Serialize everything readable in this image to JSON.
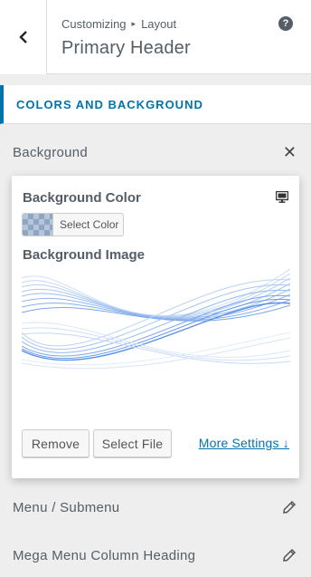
{
  "header": {
    "breadcrumb": [
      "Customizing",
      "Layout"
    ],
    "breadcrumb_separator": "▸",
    "title": "Primary Header",
    "help_icon": "question-mark-icon",
    "back_icon": "chevron-left-icon"
  },
  "section": {
    "heading": "Colors and Background",
    "accent_color": "#0073aa"
  },
  "rows": {
    "background": {
      "label": "Background",
      "action_icon": "close-icon",
      "action_glyph": "✕"
    },
    "menu_submenu": {
      "label": "Menu / Submenu",
      "action_icon": "pencil-icon"
    },
    "mega_menu": {
      "label": "Mega Menu Column Heading",
      "action_icon": "pencil-icon"
    }
  },
  "popup": {
    "bg_color_label": "Background Color",
    "select_color_label": "Select Color",
    "device_icon": "desktop-monitor-icon",
    "bg_image_label": "Background Image",
    "remove_label": "Remove",
    "select_file_label": "Select File",
    "more_settings_label": "More Settings ↓"
  }
}
